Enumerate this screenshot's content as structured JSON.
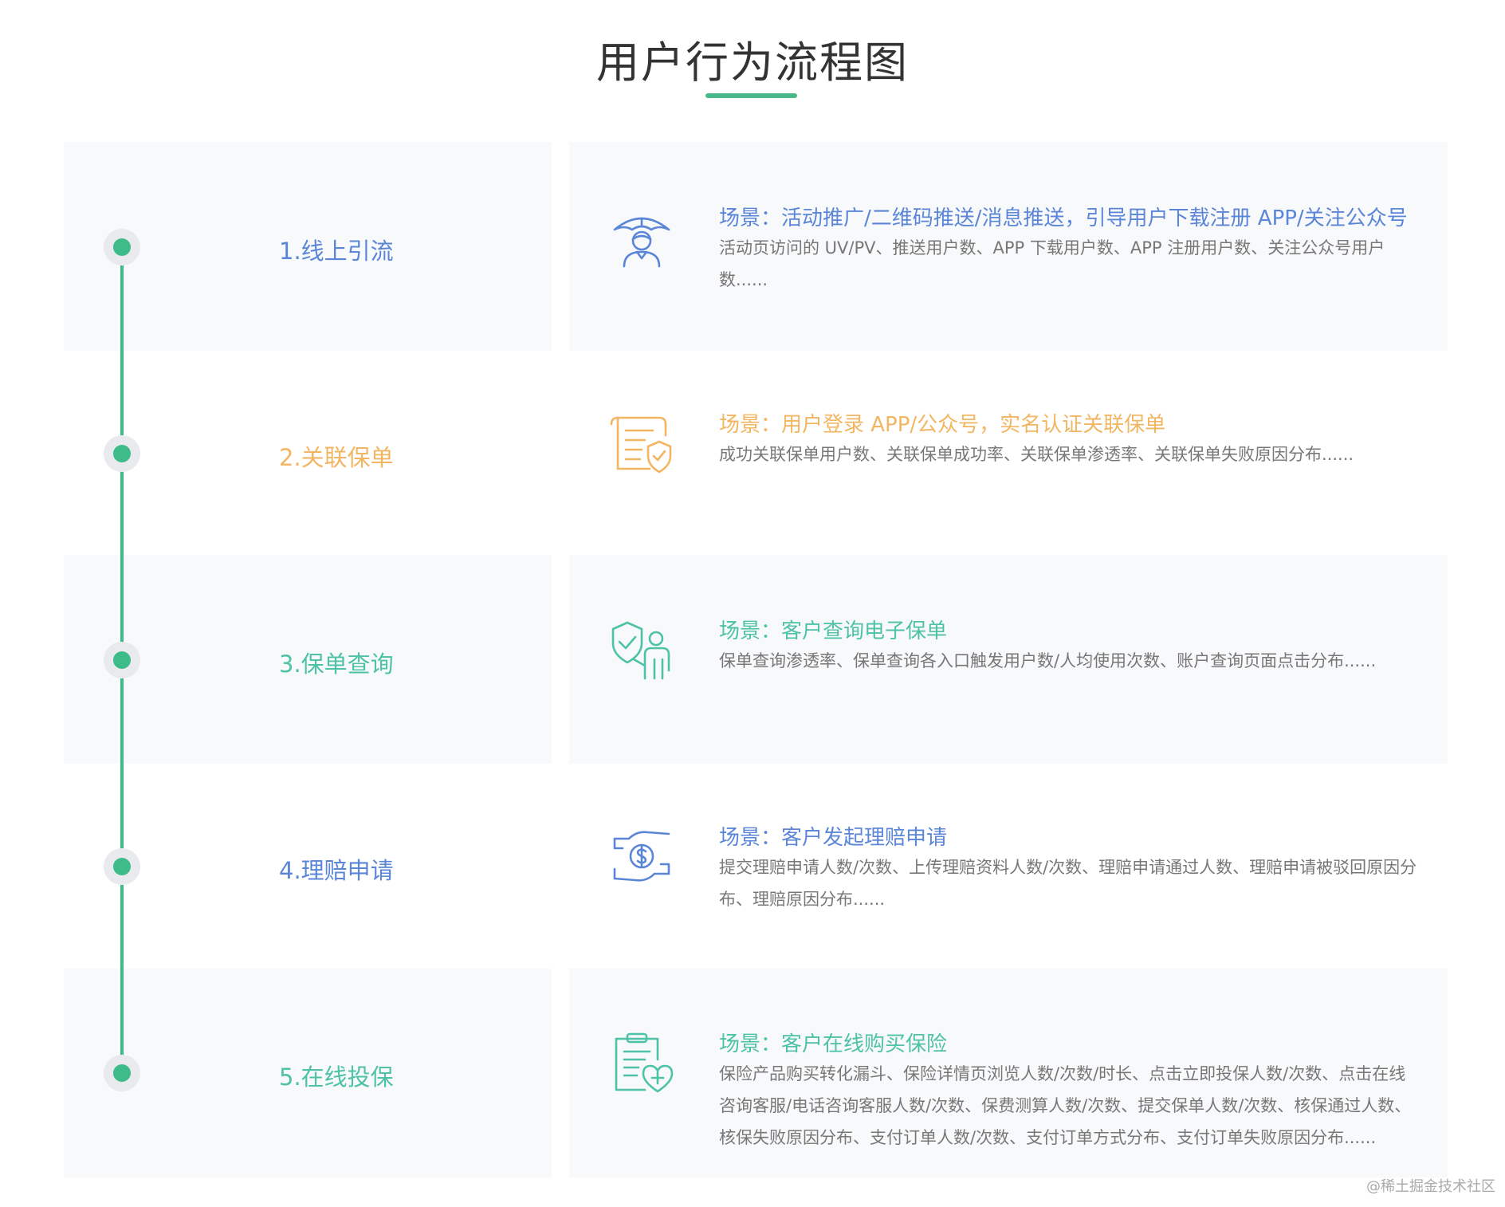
{
  "title": "用户行为流程图",
  "colors": {
    "accent": "#4ab98a",
    "line": "#3dbb88",
    "blue": "#5b86d8",
    "orange": "#f2b663",
    "teal": "#4ec2a6",
    "panel": "#f8f9fb",
    "metrics": "#777777"
  },
  "steps": [
    {
      "label": "1.线上引流",
      "scene": "场景：活动推广/二维码推送/消息推送，引导用户下载注册 APP/关注公众号",
      "metrics": "活动页访问的 UV/PV、推送用户数、APP 下载用户数、APP 注册用户数、关注公众号用户数......",
      "icon": "umbrella-person-icon",
      "color": "#5b86d8"
    },
    {
      "label": "2.关联保单",
      "scene": "场景：用户登录 APP/公众号，实名认证关联保单",
      "metrics": "成功关联保单用户数、关联保单成功率、关联保单渗透率、关联保单失败原因分布......",
      "icon": "policy-shield-icon",
      "color": "#f2b663"
    },
    {
      "label": "3.保单查询",
      "scene": "场景：客户查询电子保单",
      "metrics": "保单查询渗透率、保单查询各入口触发用户数/人均使用次数、账户查询页面点击分布......",
      "icon": "shield-person-icon",
      "color": "#4ec2a6"
    },
    {
      "label": "4.理赔申请",
      "scene": "场景：客户发起理赔申请",
      "metrics": "提交理赔申请人数/次数、上传理赔资料人数/次数、理赔申请通过人数、理赔申请被驳回原因分布、理赔原因分布......",
      "icon": "hands-dollar-icon",
      "color": "#5b86d8"
    },
    {
      "label": "5.在线投保",
      "scene": "场景：客户在线购买保险",
      "metrics": "保险产品购买转化漏斗、保险详情页浏览人数/次数/时长、点击立即投保人数/次数、点击在线咨询客服/电话咨询客服人数/次数、保费测算人数/次数、提交保单人数/次数、核保通过人数、核保失败原因分布、支付订单人数/次数、支付订单方式分布、支付订单失败原因分布......",
      "icon": "health-document-icon",
      "color": "#4ec2a6"
    }
  ],
  "watermark": "@稀土掘金技术社区"
}
